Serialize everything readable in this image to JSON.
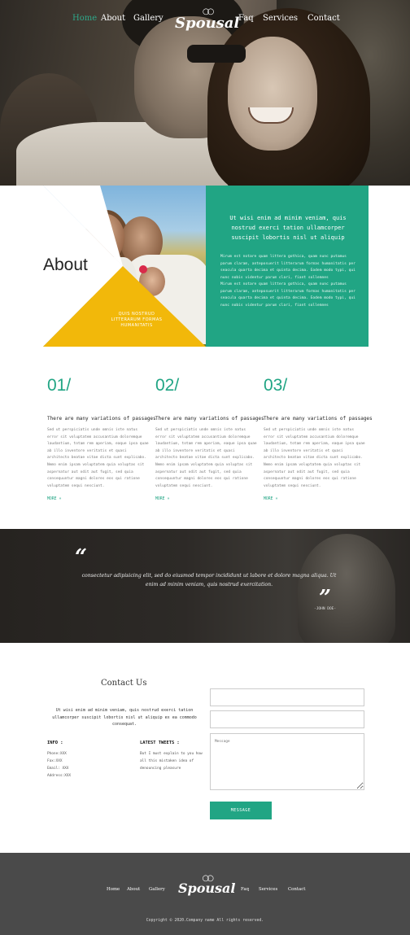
{
  "nav": {
    "items": [
      "Home",
      "About",
      "Gallery",
      "Faq",
      "Services",
      "Contact"
    ],
    "active": "Home"
  },
  "brand": {
    "name": "Spousal",
    "rings": "○○"
  },
  "about": {
    "title": "About",
    "caption": "QUIS NOSTRUD\nLITTERARUM FORMAS HUMANITATIS",
    "lead": "Ut wisi enim ad minim veniam, quis nostrud exerci tation ullamcorper suscipit lobortis nisl ut aliquip",
    "body": "Mirum est notare quam littera gothica, quam nunc putamus parum claram, anteposuerit litterarum formas humanitatis per seacula quarta decima et quinta decima. Eodem modo typi, qui nunc nobis videntur parum clari, fiant sollemnes\nMirum est notare quam littera gothica, quam nunc putamus parum claram, anteposuerit litterarum formas humanitatis per seacula quarta decima et quinta decima. Eodem modo typi, qui nunc nobis videntur parum clari, fiant sollemnes"
  },
  "features": [
    {
      "num": "01/",
      "title": "There are many variations of passages",
      "body": "Sed ut perspiciatis unde omnis iste natus error sit voluptatem accusantium doloremque laudantium, totam rem aperiam, eaque ipsa quae ab illo inventore veritatis et quasi architecto beatae vitae dicta sunt explicabo. Nemo enim ipsam voluptatem quia voluptas sit aspernatur aut odit aut fugit, sed quia consequuntur magni dolores eos qui ratione voluptatem sequi nesciunt.",
      "more": "MORE »"
    },
    {
      "num": "02/",
      "title": "There are many variations of passages",
      "body": "Sed ut perspiciatis unde omnis iste natus error sit voluptatem accusantium doloremque laudantium, totam rem aperiam, eaque ipsa quae ab illo inventore veritatis et quasi architecto beatae vitae dicta sunt explicabo. Nemo enim ipsam voluptatem quia voluptas sit aspernatur aut odit aut fugit, sed quia consequuntur magni dolores eos qui ratione voluptatem sequi nesciunt.",
      "more": "MORE »"
    },
    {
      "num": "03/",
      "title": "There are many variations of passages",
      "body": "Sed ut perspiciatis unde omnis iste natus error sit voluptatem accusantium doloremque laudantium, totam rem aperiam, eaque ipsa quae ab illo inventore veritatis et quasi architecto beatae vitae dicta sunt explicabo. Nemo enim ipsam voluptatem quia voluptas sit aspernatur aut odit aut fugit, sed quia consequuntur magni dolores eos qui ratione voluptatem sequi nesciunt.",
      "more": "MORE »"
    }
  ],
  "quote": {
    "open": "“",
    "close": "”",
    "text": "consectetur adipisicing elit, sed do eiusmod tempor incididunt ut labore et dolore magna aliqua. Ut enim ad minim veniam, quis nostrud exercitation.",
    "author": "-JOHN DOE-"
  },
  "contact": {
    "title": "Contact Us",
    "lead": "Ut wisi enim ad minim veniam, quis nostrud exerci tation ullamcorper suscipit lobortis nisl ut aliquip ex ea commodo consequat.",
    "info_head": "INFO :",
    "info_lines": [
      "Phone:XXX",
      "Fax:XXX",
      "Email: XXX",
      "Address:XXX"
    ],
    "tweets_head": "LATEST TWEETS :",
    "tweets_lines": [
      "But I must explain to you how",
      "all this mistaken idea of",
      "denouncing pleasure"
    ],
    "message_placeholder": "Message",
    "send_label": "MESSAGE"
  },
  "footer": {
    "nav": [
      "Home",
      "About",
      "Gallery",
      "Faq",
      "Services",
      "Contact"
    ],
    "copyright": "Copyright © 2020.Company name All rights reserved."
  },
  "colors": {
    "accent": "#21a584",
    "yellow": "#f2b80a",
    "footer": "#4a4a4a",
    "nav_active": "#2ea88a"
  }
}
